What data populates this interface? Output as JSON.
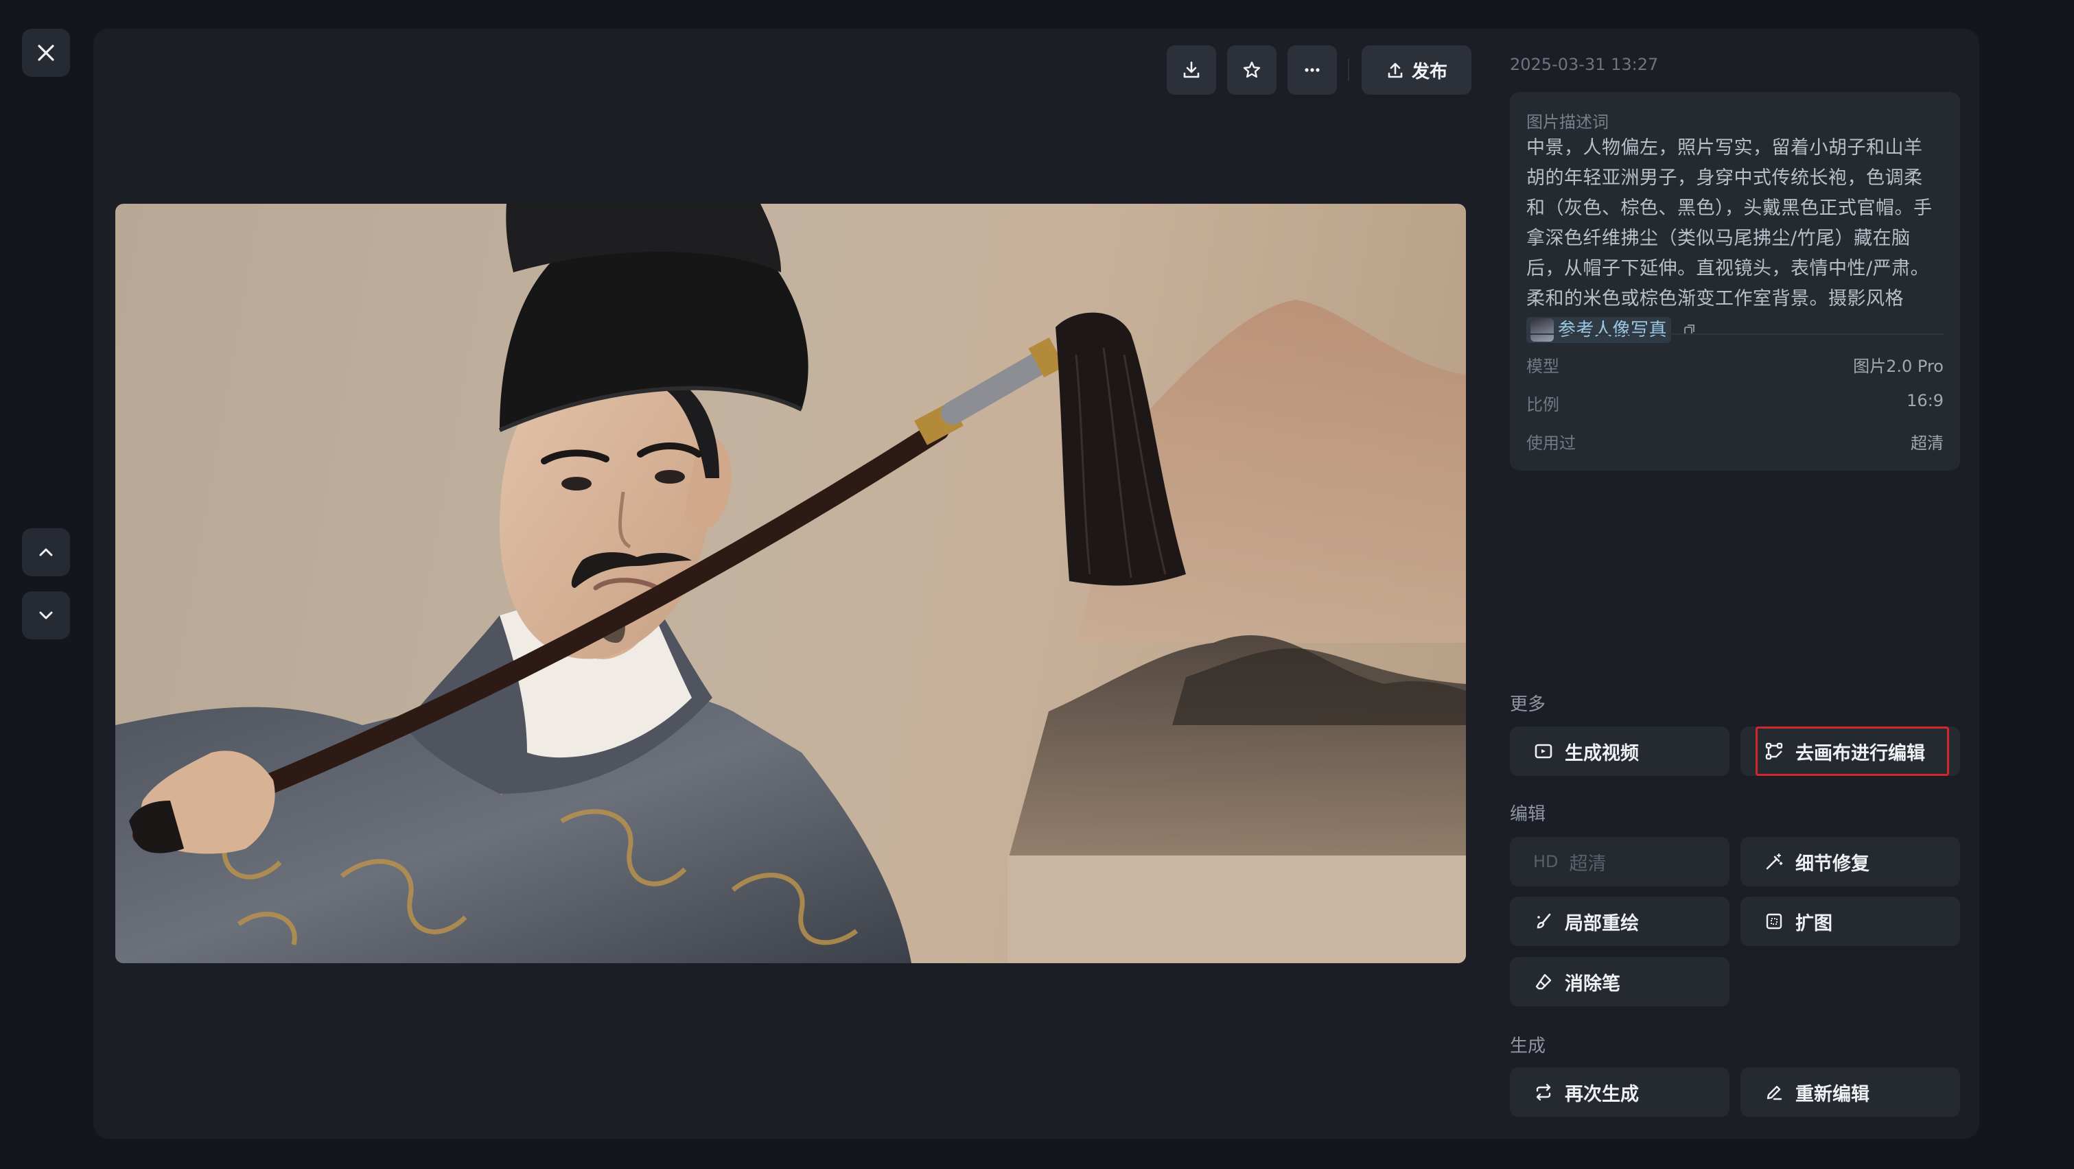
{
  "toolbar": {
    "close_icon": "close-icon",
    "prev_icon": "chevron-up-icon",
    "next_icon": "chevron-down-icon",
    "download_icon": "download-icon",
    "favorite_icon": "star-icon",
    "more_icon": "more-horizontal-icon",
    "publish_label": "发布",
    "publish_icon": "upload-icon"
  },
  "image": {
    "alt": "图片"
  },
  "details": {
    "timestamp": "2025-03-31 13:27",
    "prompt_label": "图片描述词",
    "prompt_text": "中景，人物偏左，照片写实，留着小胡子和山羊胡的年轻亚洲男子，身穿中式传统长袍，色调柔和（灰色、棕色、黑色），头戴黑色正式官帽。手拿深色纤维拂尘（类似马尾拂尘/竹尾）藏在脑后，从帽子下延伸。直视镜头，表情中性/严肃。柔和的米色或棕色渐变工作室背景。摄影风格",
    "reference_label": "参考人像写真",
    "meta": [
      {
        "key": "模型",
        "value": "图片2.0 Pro"
      },
      {
        "key": "比例",
        "value": "16:9"
      },
      {
        "key": "使用过",
        "value": "超清"
      }
    ]
  },
  "sections": {
    "more": "更多",
    "edit": "编辑",
    "generate": "生成"
  },
  "actions": {
    "generate_video": "生成视频",
    "canvas_edit": "去画布进行编辑",
    "hd_prefix": "HD",
    "hd": "超清",
    "detail_fix": "细节修复",
    "inpaint": "局部重绘",
    "outpaint": "扩图",
    "eraser": "消除笔",
    "regenerate": "再次生成",
    "reedit": "重新编辑"
  },
  "colors": {
    "background": "#14161b",
    "panel": "#1b1e25",
    "button": "#252930",
    "highlight": "#d4262e",
    "reference_chip": "#9cc7e4"
  }
}
